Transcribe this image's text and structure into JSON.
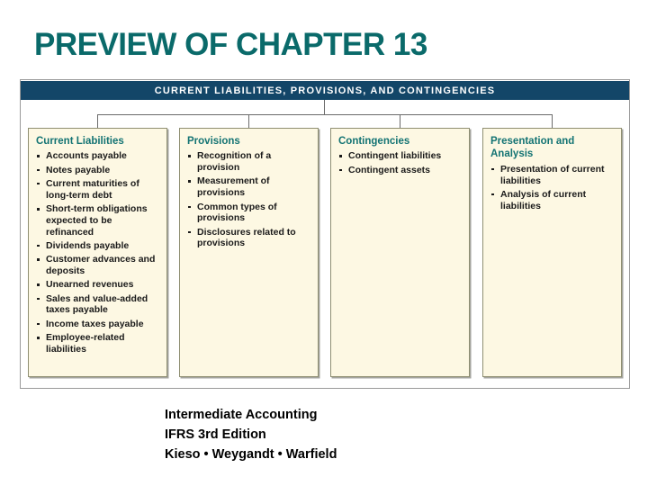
{
  "page": {
    "title": "PREVIEW OF CHAPTER 13",
    "title_color": "#0a6a6a"
  },
  "diagram": {
    "root_header": {
      "label": "CURRENT LIABILITIES, PROVISIONS, AND CONTINGENCIES",
      "background_color": "#134668",
      "text_color": "#ffffff"
    },
    "box_fill_color": "#fdf8e3",
    "heading_color": "#137373",
    "categories": [
      {
        "title": "Current Liabilities",
        "items": [
          "Accounts payable",
          "Notes payable",
          "Current maturities of long-term debt",
          "Short-term obligations expected to be refinanced",
          "Dividends payable",
          "Customer advances and deposits",
          "Unearned revenues",
          "Sales and value-added taxes payable",
          "Income taxes payable",
          "Employee-related liabilities"
        ]
      },
      {
        "title": "Provisions",
        "items": [
          "Recognition of a provision",
          "Measurement of provisions",
          "Common types of provisions",
          "Disclosures related to provisions"
        ]
      },
      {
        "title": "Contingencies",
        "items": [
          "Contingent liabilities",
          "Contingent assets"
        ]
      },
      {
        "title": "Presentation and Analysis",
        "items": [
          "Presentation of current liabilities",
          "Analysis of current liabilities"
        ]
      }
    ]
  },
  "footer": {
    "line1": "Intermediate Accounting",
    "line2": "IFRS 3rd Edition",
    "line3": "Kieso  • Weygandt  • Warfield"
  }
}
